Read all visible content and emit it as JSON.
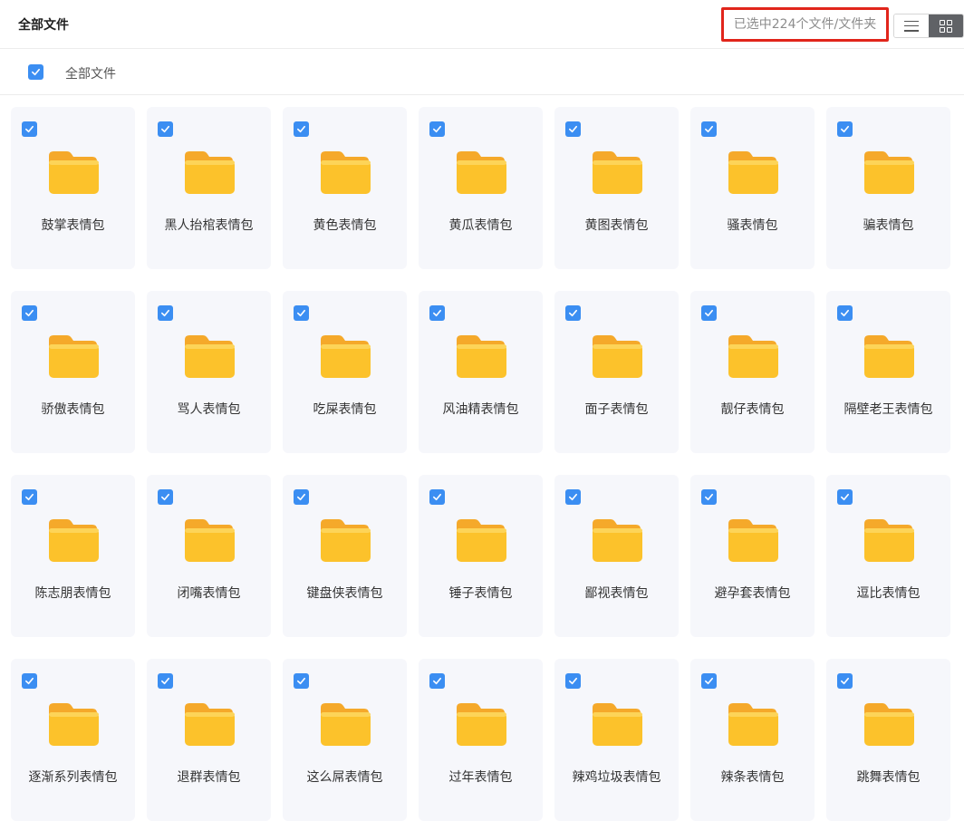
{
  "header": {
    "title": "全部文件",
    "selection_status": "已选中224个文件/文件夹"
  },
  "view_switch": {
    "active": "grid"
  },
  "subbar": {
    "breadcrumb": "全部文件",
    "select_all_checked": true
  },
  "colors": {
    "accent": "#3b8ef2",
    "highlight_border": "#e1251b",
    "folder": "#fcc22b",
    "tile_bg": "#f6f7fb"
  },
  "folders": [
    "鼓掌表情包",
    "黑人抬棺表情包",
    "黄色表情包",
    "黄瓜表情包",
    "黄图表情包",
    "骚表情包",
    "骗表情包",
    "骄傲表情包",
    "骂人表情包",
    "吃屎表情包",
    "风油精表情包",
    "面子表情包",
    "靓仔表情包",
    "隔壁老王表情包",
    "陈志朋表情包",
    "闭嘴表情包",
    "键盘侠表情包",
    "锤子表情包",
    "鄙视表情包",
    "避孕套表情包",
    "逗比表情包",
    "逐渐系列表情包",
    "退群表情包",
    "这么屌表情包",
    "过年表情包",
    "辣鸡垃圾表情包",
    "辣条表情包",
    "跳舞表情包"
  ]
}
